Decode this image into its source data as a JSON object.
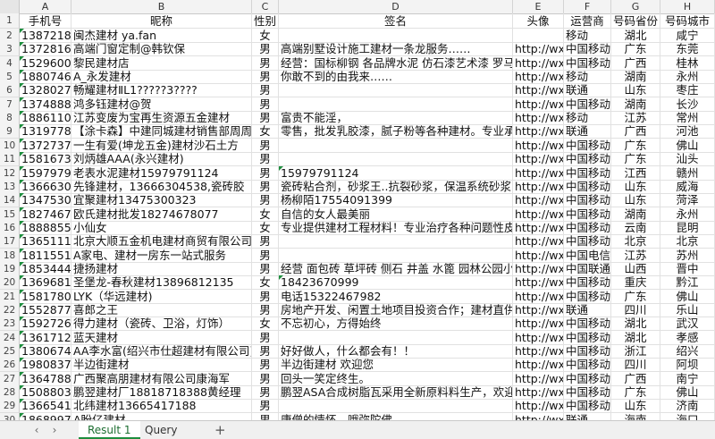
{
  "columns": [
    "A",
    "B",
    "C",
    "D",
    "E",
    "F",
    "G",
    "H"
  ],
  "header": [
    "手机号",
    "昵称",
    "性别",
    "签名",
    "头像",
    "运营商",
    "号码省份",
    "号码城市"
  ],
  "rows": [
    {
      "n": "2",
      "cells": [
        "138721878",
        "闽杰建材 ya.fan",
        "女",
        "",
        "",
        "移动",
        "湖北",
        "咸宁"
      ]
    },
    {
      "n": "3",
      "cells": [
        "137281611",
        "高端门窗定制@韩钦保",
        "男",
        "高端别墅设计施工建材一条龙服务……",
        "http://wx.c",
        "中国移动",
        "广东",
        "东莞"
      ]
    },
    {
      "n": "4",
      "cells": [
        "152960080",
        "黎民建材店",
        "男",
        "经营：国标柳钢 各品牌水泥 仿石漆艺术漆 罗马柱",
        "http://wx.c",
        "中国移动",
        "广西",
        "桂林"
      ]
    },
    {
      "n": "5",
      "cells": [
        "188074602",
        "A_永发建材",
        "男",
        "你敢不到的由我来……",
        "http://wx.c",
        "移动",
        "湖南",
        "永州"
      ]
    },
    {
      "n": "6",
      "cells": [
        "132802711",
        "畅耀建材ⅡL1?????3????",
        "男",
        "",
        "http://wx.c",
        "联通",
        "山东",
        "枣庄"
      ]
    },
    {
      "n": "7",
      "cells": [
        "137488838",
        "鸿多钰建材@贺",
        "男",
        "",
        "http://wx.c",
        "中国移动",
        "湖南",
        "长沙"
      ]
    },
    {
      "n": "8",
      "cells": [
        "188611001",
        "江苏变废为宝再生资源五金建材",
        "男",
        "富贵不能淫，",
        "http://wx.c",
        "移动",
        "江苏",
        "常州"
      ]
    },
    {
      "n": "9",
      "cells": [
        "131977866",
        "【涂卡森】中建同城建材销售部周周",
        "女",
        "零售，批发乳胶漆，腻子粉等各种建材。专业承接",
        "http://wx.c",
        "联通",
        "广西",
        "河池"
      ]
    },
    {
      "n": "10",
      "cells": [
        "137273707",
        "一生有爱(坤龙五金)建材沙石土方",
        "男",
        "",
        "http://wx.c",
        "中国移动",
        "广东",
        "佛山"
      ]
    },
    {
      "n": "11",
      "cells": [
        "158167315",
        "刘炳雄AAA(永兴建材)",
        "男",
        "",
        "http://wx.c",
        "中国移动",
        "广东",
        "汕头"
      ]
    },
    {
      "n": "12",
      "cells": [
        "159797911",
        "老表水泥建材15979791124",
        "男",
        "15979791124",
        "http://wx.c",
        "中国移动",
        "江西",
        "赣州"
      ]
    },
    {
      "n": "13",
      "cells": [
        "136663045",
        "先锋建材，13666304538,瓷砖胶",
        "男",
        "瓷砖粘合剂，砂浆王..抗裂砂浆，保温系统砂浆，「",
        "http://wx.c",
        "中国移动",
        "山东",
        "威海"
      ]
    },
    {
      "n": "14",
      "cells": [
        "134753003",
        "宜聚建材13475300323",
        "男",
        "杨柳陌17554091399",
        "http://wx.c",
        "中国移动",
        "山东",
        "菏泽"
      ]
    },
    {
      "n": "15",
      "cells": [
        "182746780",
        "欧氏建材批发18274678077",
        "女",
        "自信的女人最美丽",
        "http://wx.c",
        "中国移动",
        "湖南",
        "永州"
      ]
    },
    {
      "n": "16",
      "cells": [
        "188885526",
        "小仙女",
        "女",
        "专业提供建材工程材料！专业治疗各种问题性皮肤",
        "http://wx.c",
        "中国移动",
        "云南",
        "昆明"
      ]
    },
    {
      "n": "17",
      "cells": [
        "136511182",
        "北京大顺五金机电建材商贸有限公司",
        "男",
        "",
        "http://wx.c",
        "中国移动",
        "北京",
        "北京"
      ]
    },
    {
      "n": "18",
      "cells": [
        "181155197",
        "A家电、建材一房东一站式服务",
        "男",
        "",
        "http://wx.c",
        "中国电信",
        "江苏",
        "苏州"
      ]
    },
    {
      "n": "19",
      "cells": [
        "185344466",
        "捷扬建材",
        "男",
        "经营 面包砖 草坪砖 侧石 井盖 水篦 园林公园小区",
        "http://wx.c",
        "中国联通",
        "山西",
        "晋中"
      ]
    },
    {
      "n": "20",
      "cells": [
        "136968121",
        "圣堡龙-春秋建材13896812135",
        "女",
        "18423670999",
        "http://wx.c",
        "中国移动",
        "重庆",
        "黔江"
      ]
    },
    {
      "n": "21",
      "cells": [
        "158178005",
        "LYK（华远建材)",
        "男",
        "电话15322467982",
        "http://wx.c",
        "中国移动",
        "广东",
        "佛山"
      ]
    },
    {
      "n": "22",
      "cells": [
        "155287773",
        "喜郎之王",
        "男",
        "房地产开发、闲置土地项目投资合作；建材直供。",
        "http://wx.c",
        "联通",
        "四川",
        "乐山"
      ]
    },
    {
      "n": "23",
      "cells": [
        "159272679",
        "得力建材（瓷砖、卫浴，灯饰）",
        "女",
        "不忘初心，方得始终",
        "http://wx.c",
        "中国移动",
        "湖北",
        "武汉"
      ]
    },
    {
      "n": "24",
      "cells": [
        "136171272",
        "蓝天建材",
        "男",
        "",
        "http://wx.c",
        "中国移动",
        "湖北",
        "孝感"
      ]
    },
    {
      "n": "25",
      "cells": [
        "138067402",
        "AA李水富(绍兴市仕超建材有限公司)",
        "男",
        "好好做人，什么都会有！！",
        "http://wx.c",
        "中国移动",
        "浙江",
        "绍兴"
      ]
    },
    {
      "n": "26",
      "cells": [
        "198083778",
        "半边街建材",
        "男",
        "半边街建材 欢迎您",
        "http://wx.c",
        "中国移动",
        "四川",
        "阿坝"
      ]
    },
    {
      "n": "27",
      "cells": [
        "136478836",
        "广西聚高朋建材有限公司康海军",
        "男",
        "回头一笑定终生。",
        "http://wx.c",
        "中国移动",
        "广西",
        "南宁"
      ]
    },
    {
      "n": "28",
      "cells": [
        "150880363",
        "鹏翌建材厂18818718388黄经理",
        "男",
        "鹏翌ASA合成树脂瓦采用全新原料料生产，欢迎到",
        "http://wx.c",
        "中国移动",
        "广东",
        "佛山"
      ]
    },
    {
      "n": "29",
      "cells": [
        "136654171",
        "北纬建材13665417188",
        "男",
        "",
        "http://wx.c",
        "中国移动",
        "山东",
        "济南"
      ]
    },
    {
      "n": "30",
      "cells": [
        "186899719",
        "A盼亿建材",
        "男",
        "唐僧的情怀，哦弥陀佛。",
        "http://wx.c",
        "联通",
        "海南",
        "海口"
      ]
    }
  ],
  "tabs": {
    "prev": "‹",
    "next": "›",
    "items": [
      "Result 1",
      "Query"
    ],
    "add": "+"
  }
}
